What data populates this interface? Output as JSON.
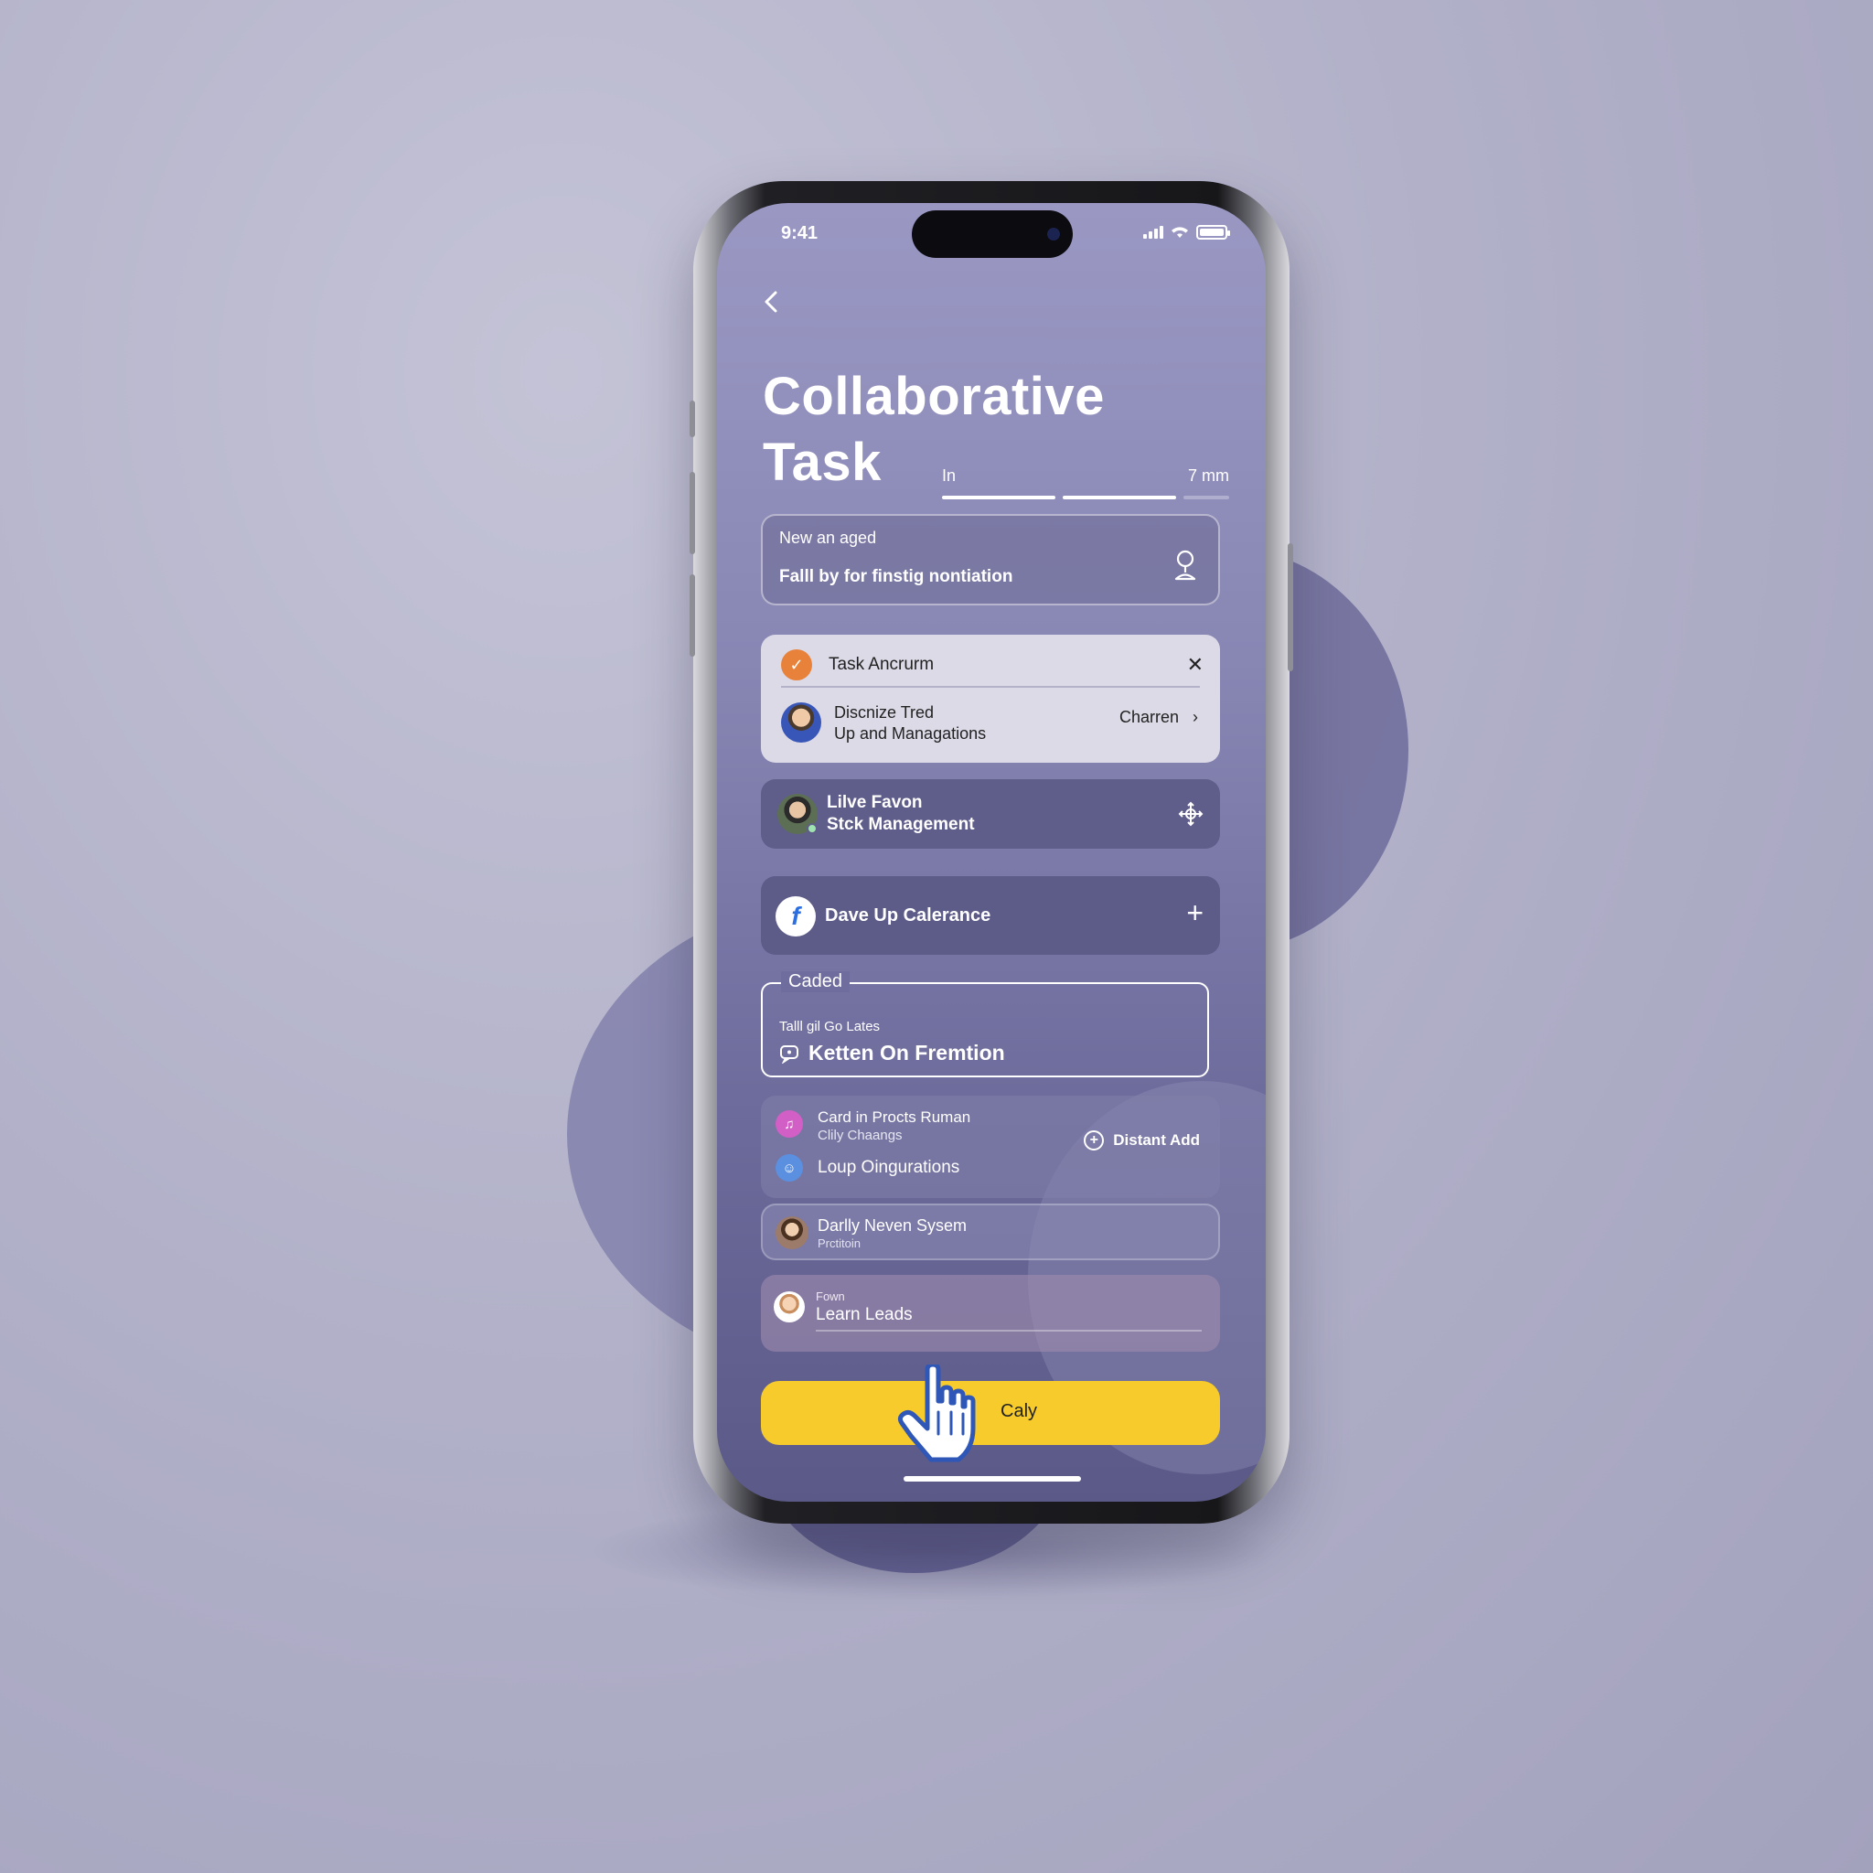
{
  "status": {
    "time": "9:41"
  },
  "header": {
    "title_line1": "Collaborative",
    "title_line2": "Task",
    "range_start": "In",
    "range_end": "7 mm"
  },
  "notice_card": {
    "label": "New an aged",
    "value": "Falll by for finstig nontiation",
    "icon": "person-pin-icon"
  },
  "task_card": {
    "title": "Task Ancrurm",
    "assignee_line1": "Discnize Tred",
    "assignee_line2": "Up and Managations",
    "action": "Charren"
  },
  "live_card": {
    "line1": "Lilve Favon",
    "line2": "Stck Management"
  },
  "dave_card": {
    "label": "Dave Up Calerance"
  },
  "caded_field": {
    "legend": "Caded",
    "sublabel": "Talll gil Go Lates",
    "value": "Ketten On Fremtion"
  },
  "group_card": {
    "item1_title": "Card in Procts Ruman",
    "item1_sub": "Clily Chaangs",
    "item2_title": "Loup Oingurations",
    "action": "Distant Add"
  },
  "daily_card": {
    "title": "Darlly Neven Sysem",
    "sub": "Prctitoin"
  },
  "learn_card": {
    "sub": "Fown",
    "title": "Learn Leads"
  },
  "cta": {
    "label": "Caly"
  },
  "colors": {
    "accent": "#f6cb2b",
    "screen_top": "#9a98c3",
    "screen_bottom": "#5b5987"
  }
}
